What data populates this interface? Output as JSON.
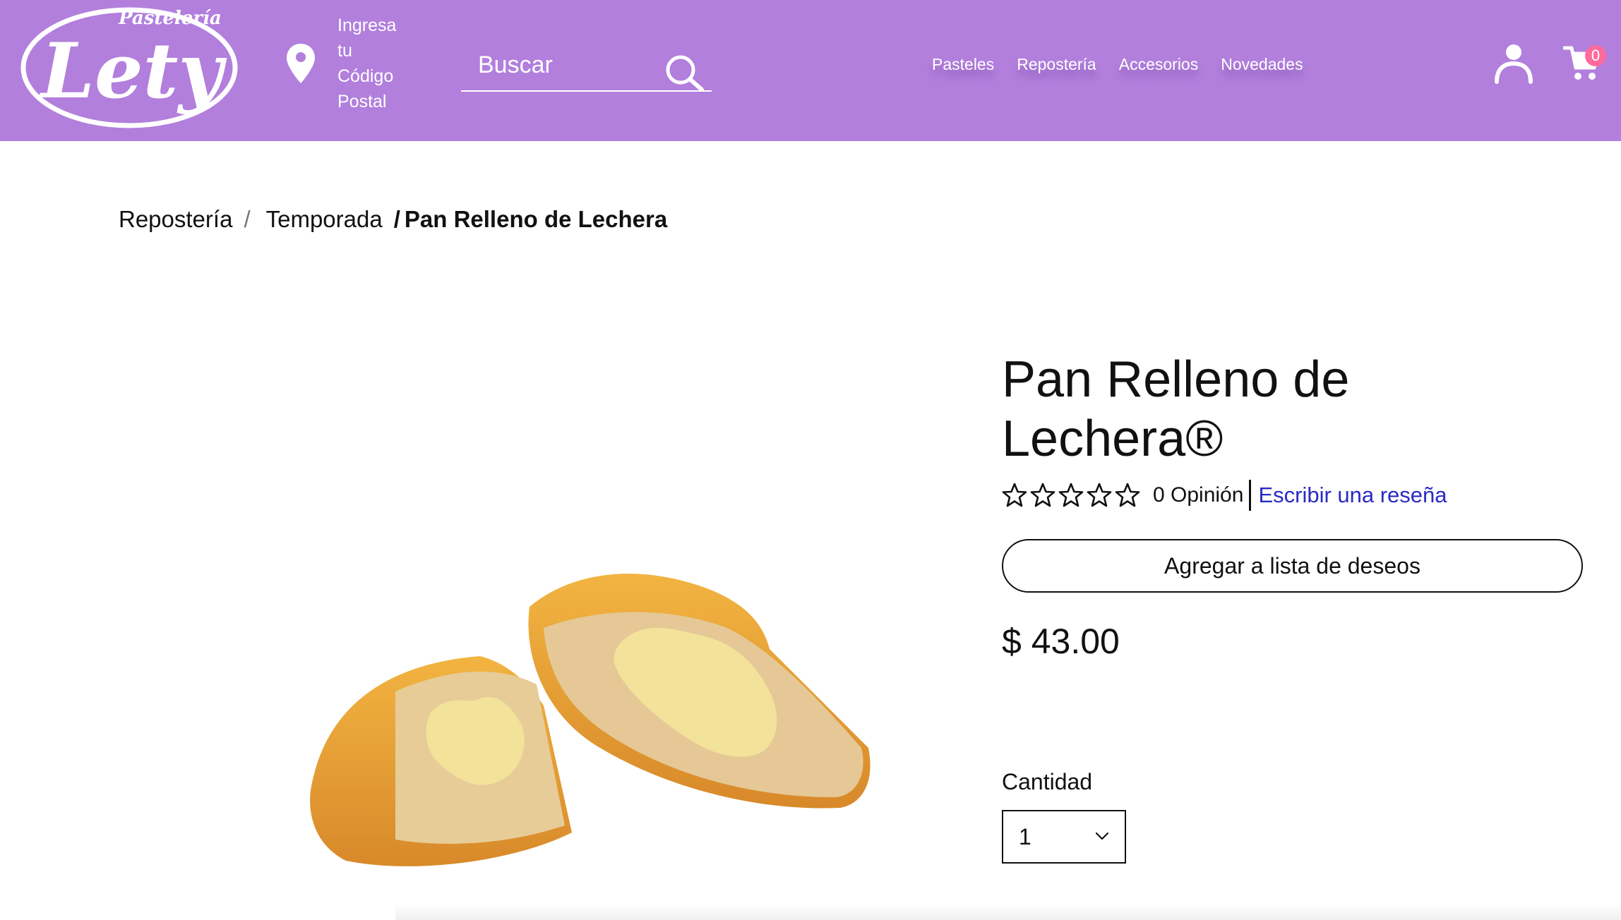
{
  "header": {
    "brand_top": "Pastelería",
    "brand_name": "Lety",
    "location_prompt": [
      "Ingresa",
      "tu",
      "Código",
      "Postal"
    ],
    "search_placeholder": "Buscar",
    "nav": [
      "Pasteles",
      "Repostería",
      "Accesorios",
      "Novedades"
    ],
    "cart_count": "0"
  },
  "breadcrumb": {
    "items": [
      "Repostería",
      "Temporada"
    ],
    "separator": "/",
    "current": "Pan Relleno de Lechera"
  },
  "product": {
    "title_line1": "Pan Relleno de",
    "title_line2": "Lechera®",
    "rating": 0,
    "rating_max": 5,
    "opinions": "0 Opinión",
    "review_link": "Escribir una reseña",
    "wishlist_label": "Agregar a lista de deseos",
    "price": "$ 43.00",
    "quantity_label": "Cantidad",
    "quantity_value": "1"
  },
  "colors": {
    "header_bg": "#b27fdd",
    "badge": "#ff6b9d",
    "link": "#2a2ac4"
  },
  "icons": {
    "location": "map-pin-icon",
    "search": "search-icon",
    "user": "user-icon",
    "cart": "cart-icon",
    "star": "star-outline-icon",
    "chevron": "chevron-down-icon"
  }
}
